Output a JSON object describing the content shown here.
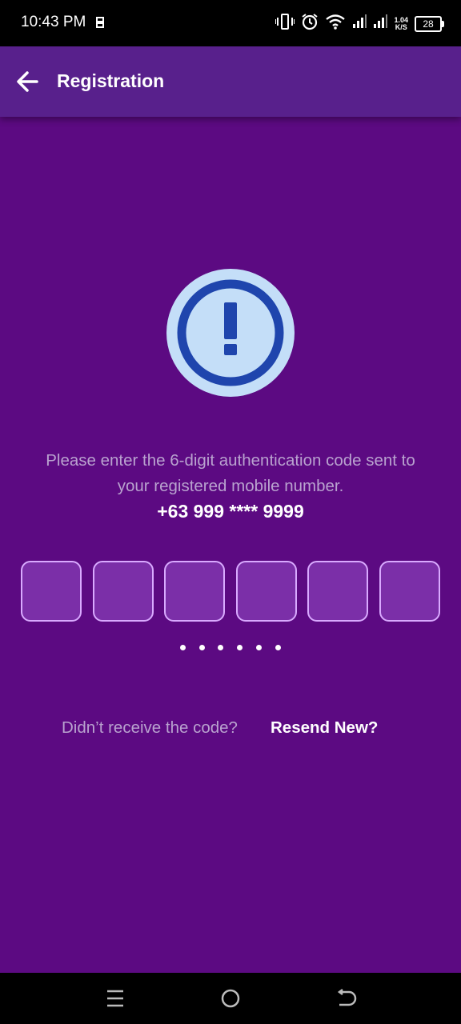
{
  "status_bar": {
    "time": "10:43 PM",
    "network_speed_value": "1.04",
    "network_speed_unit": "K/S",
    "battery": "28"
  },
  "app_bar": {
    "title": "Registration",
    "back_icon": "arrow-left-icon"
  },
  "alert": {
    "icon": "alert-circle-icon",
    "colors": {
      "outer": "#c4def8",
      "ring": "#1f45ad"
    }
  },
  "instruction": {
    "line1": "Please enter the 6-digit authentication code sent to",
    "line2": "your registered mobile number.",
    "phone": "+63 999 **** 9999"
  },
  "otp": {
    "boxes": [
      "",
      "",
      "",
      "",
      "",
      ""
    ],
    "dot_indicator": "• • • • • •"
  },
  "resend": {
    "prompt": "Didn’t receive the code?",
    "link": "Resend New?"
  },
  "nav_bar": {
    "icons": [
      "menu-icon",
      "home-circle-icon",
      "back-icon"
    ]
  },
  "colors": {
    "background": "#5c0a82",
    "app_bar": "#58208c",
    "box_fill": "#7b2fa8",
    "box_border": "#d9aaff",
    "muted_text": "#b9a2cf"
  }
}
